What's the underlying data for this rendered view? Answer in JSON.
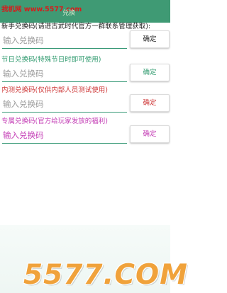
{
  "watermark_top": "我机网 www.5577.com",
  "app_bar": {
    "title": "兑换"
  },
  "sections": [
    {
      "label": "新手兑换码(请进古武时代官方一群联系管理获取):",
      "label_color": "#222222",
      "placeholder": "输入兑换码",
      "placeholder_color": "#9a9a9a",
      "button": "确定",
      "button_color": "#222222"
    },
    {
      "label": "节日兑换码(特殊节日时即可使用)",
      "label_color": "#2f9a6e",
      "placeholder": "输入兑换码",
      "placeholder_color": "#9a9a9a",
      "button": "确定",
      "button_color": "#2f9a6e"
    },
    {
      "label": "内测兑换码(仅供内部人员测试使用)",
      "label_color": "#cf3a3a",
      "placeholder": "输入兑换码",
      "placeholder_color": "#9a9a9a",
      "button": "确定",
      "button_color": "#cf3a3a"
    },
    {
      "label": "专属兑换码(官方给玩家发放的福利)",
      "label_color": "#c43fb6",
      "placeholder": "输入兑换码",
      "placeholder_color": "#c43fb6",
      "button": "确定",
      "button_color": "#c43fb6"
    }
  ],
  "watermark_bottom": "5577.COM"
}
